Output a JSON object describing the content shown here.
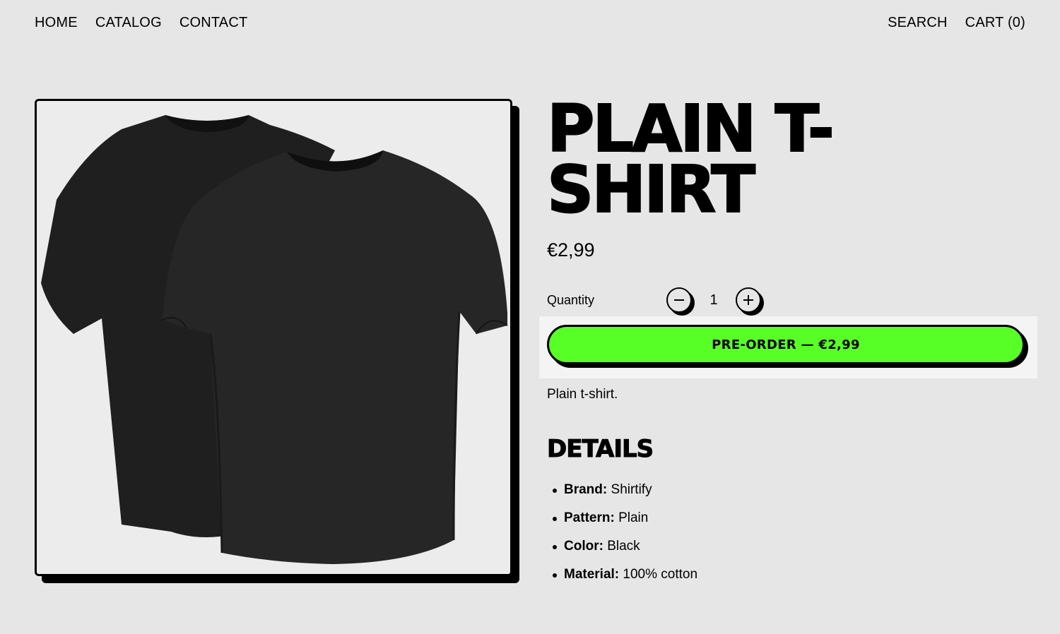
{
  "header": {
    "nav": [
      "HOME",
      "CATALOG",
      "CONTACT"
    ],
    "search": "SEARCH",
    "cart": "CART (0)"
  },
  "product": {
    "title": "PLAIN T-SHIRT",
    "price": "€2,99",
    "quantity_label": "Quantity",
    "quantity": "1",
    "decrement_icon": "minus-icon",
    "increment_icon": "plus-icon",
    "cta_label": "PRE-ORDER — €2,99",
    "description": "Plain t-shirt.",
    "image": "black-tshirts-photo"
  },
  "details": {
    "heading": "DETAILS",
    "items": [
      {
        "key": "Brand:",
        "value": "Shirtify"
      },
      {
        "key": "Pattern:",
        "value": "Plain"
      },
      {
        "key": "Color:",
        "value": "Black"
      },
      {
        "key": "Material:",
        "value": "100% cotton"
      }
    ]
  },
  "colors": {
    "background": "#e6e6e6",
    "accent": "#58ff26",
    "ink": "#000000"
  }
}
